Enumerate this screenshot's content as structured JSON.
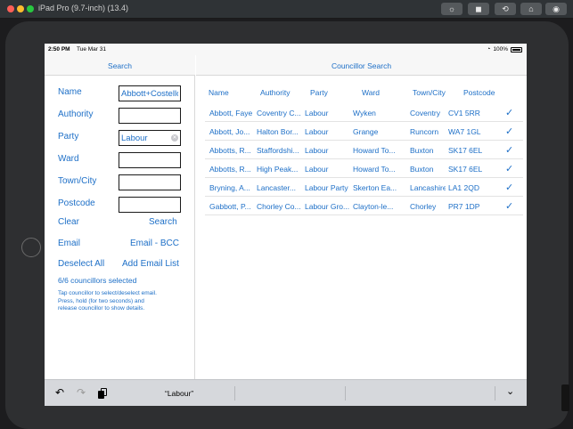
{
  "window": {
    "title": "iPad Pro (9.7-inch) (13.4)"
  },
  "status_bar": {
    "time": "2:50 PM",
    "date": "Tue Mar 31",
    "battery": "100%"
  },
  "master": {
    "title": "Search",
    "fields": [
      {
        "label": "Name",
        "value": "Abbott+Costello"
      },
      {
        "label": "Authority",
        "value": ""
      },
      {
        "label": "Party",
        "value": "Labour"
      },
      {
        "label": "Ward",
        "value": ""
      },
      {
        "label": "Town/City",
        "value": ""
      },
      {
        "label": "Postcode",
        "value": ""
      }
    ],
    "clear_label": "Clear",
    "search_label": "Search",
    "email_label": "Email",
    "email_bcc_label": "Email - BCC",
    "deselect_all_label": "Deselect All",
    "add_email_list_label": "Add Email List",
    "selected_count": "6/6 councillors selected",
    "help_lines": [
      "Tap councillor to select/deselect email.",
      "Press, hold (for two seconds) and",
      "release councillor to show details."
    ]
  },
  "detail": {
    "title": "Councillor Search",
    "columns": [
      "Name",
      "Authority",
      "Party",
      "Ward",
      "Town/City",
      "Postcode"
    ],
    "rows": [
      {
        "name": "Abbott, Faye",
        "authority": "Coventry C...",
        "party": "Labour",
        "ward": "Wyken",
        "town": "Coventry",
        "postcode": "CV1 5RR",
        "check": "✓"
      },
      {
        "name": "Abbott, Jo...",
        "authority": "Halton Bor...",
        "party": "Labour",
        "ward": "Grange",
        "town": "Runcorn",
        "postcode": "WA7 1GL",
        "check": "✓"
      },
      {
        "name": "Abbotts, R...",
        "authority": "Staffordshi...",
        "party": "Labour",
        "ward": "Howard To...",
        "town": "Buxton",
        "postcode": "SK17 6EL",
        "check": "✓"
      },
      {
        "name": "Abbotts, R...",
        "authority": "High Peak...",
        "party": "Labour",
        "ward": "Howard To...",
        "town": "Buxton",
        "postcode": "SK17 6EL",
        "check": "✓"
      },
      {
        "name": "Bryning, A...",
        "authority": "Lancaster...",
        "party": "Labour Party",
        "ward": "Skerton Ea...",
        "town": "Lancashire",
        "postcode": "LA1 2QD",
        "check": "✓"
      },
      {
        "name": "Gabbott, P...",
        "authority": "Chorley Co...",
        "party": "Labour Gro...",
        "ward": "Clayton-le...",
        "town": "Chorley",
        "postcode": "PR7 1DP",
        "check": "✓"
      }
    ]
  },
  "keyboard_bar": {
    "suggestion": "“Labour”"
  },
  "icons": {
    "undo": "↶",
    "redo": "↷",
    "dismiss": "⌄",
    "check": "check-icon",
    "wifi": "wifi-icon",
    "battery": "battery-icon",
    "home": "home-icon",
    "screenshot": "camera-icon",
    "rotate": "rotate-icon",
    "brightness": "brightness-icon",
    "stop": "stop-icon"
  },
  "colors": {
    "accent": "#1d6fc7",
    "frame": "#2e2f31",
    "titlebar": "#2f3336"
  }
}
